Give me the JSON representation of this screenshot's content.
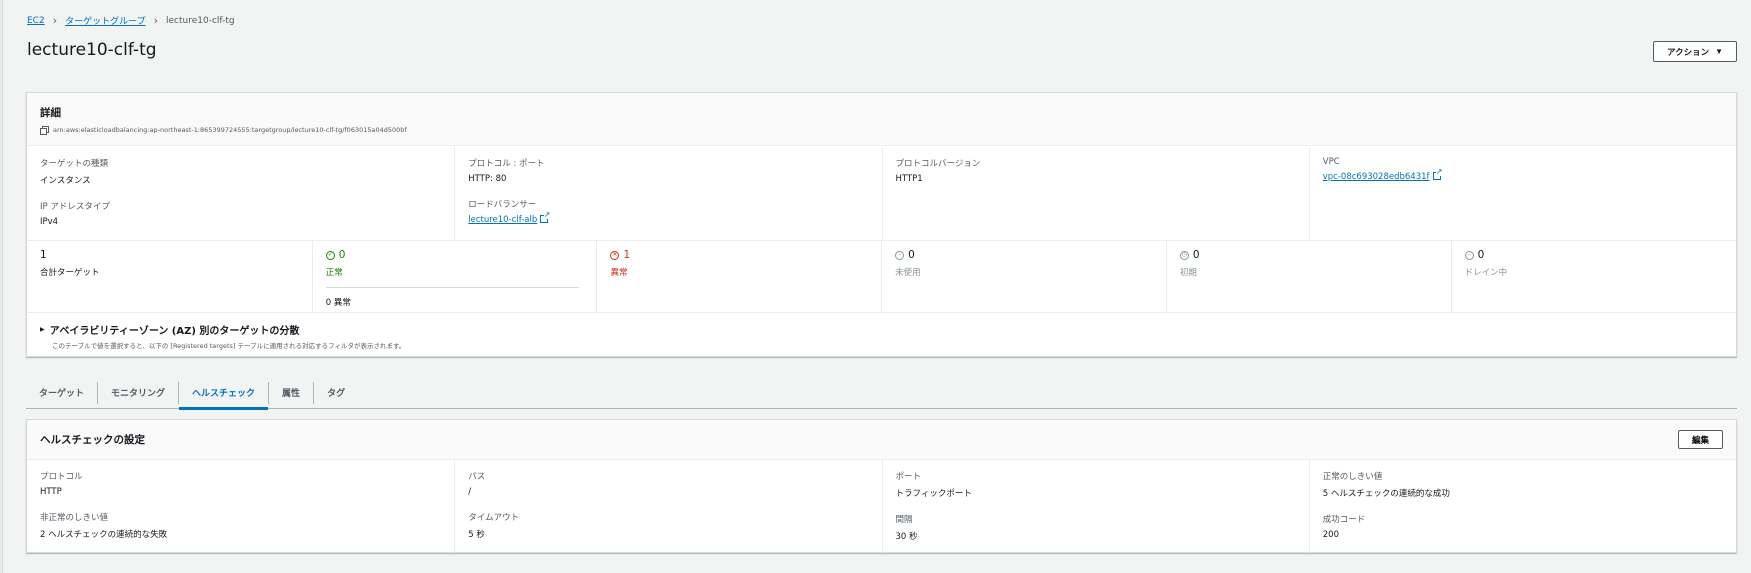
{
  "breadcrumb": {
    "items": [
      "EC2",
      "ターゲットグループ"
    ],
    "current": "lecture10-clf-tg"
  },
  "page": {
    "title": "lecture10-clf-tg",
    "action_label": "アクション"
  },
  "details": {
    "title": "詳細",
    "arn": "arn:aws:elasticloadbalancing:ap-northeast-1:865399724555:targetgroup/lecture10-clf-tg/f063015a04d500bf",
    "target_type_label": "ターゲットの種類",
    "target_type_value": "インスタンス",
    "ip_type_label": "IP アドレスタイプ",
    "ip_type_value": "IPv4",
    "protocol_port_label": "プロトコル : ポート",
    "protocol_port_value": "HTTP: 80",
    "load_balancer_label": "ロードバランサー",
    "load_balancer_value": "lecture10-clf-alb",
    "protocol_version_label": "プロトコルバージョン",
    "protocol_version_value": "HTTP1",
    "vpc_label": "VPC",
    "vpc_value": "vpc-08c693028edb6431f"
  },
  "counts": {
    "total_value": "1",
    "total_label": "合計ターゲット",
    "healthy_value": "0",
    "healthy_label": "正常",
    "healthy_sub": "0 異常",
    "unhealthy_value": "1",
    "unhealthy_label": "異常",
    "unused_value": "0",
    "unused_label": "未使用",
    "initial_value": "0",
    "initial_label": "初期",
    "draining_value": "0",
    "draining_label": "ドレイン中"
  },
  "az": {
    "title": "アベイラビリティーゾーン (AZ) 別のターゲットの分散",
    "desc": "このテーブルで値を選択すると、以下の [Registered targets] テーブルに適用される対応するフィルタが表示されます。"
  },
  "tabs": [
    "ターゲット",
    "モニタリング",
    "ヘルスチェック",
    "属性",
    "タグ"
  ],
  "health_check": {
    "title": "ヘルスチェックの設定",
    "edit_label": "編集",
    "protocol_label": "プロトコル",
    "protocol_value": "HTTP",
    "path_label": "パス",
    "path_value": "/",
    "port_label": "ポート",
    "port_value": "トラフィックポート",
    "healthy_threshold_label": "正常のしきい値",
    "healthy_threshold_value": "5 ヘルスチェックの連続的な成功",
    "unhealthy_threshold_label": "非正常のしきい値",
    "unhealthy_threshold_value": "2 ヘルスチェックの連続的な失敗",
    "timeout_label": "タイムアウト",
    "timeout_value": "5 秒",
    "interval_label": "間隔",
    "interval_value": "30 秒",
    "success_codes_label": "成功コード",
    "success_codes_value": "200"
  },
  "colors": {
    "link": "#0073bb",
    "healthy": "#1d8102",
    "unhealthy": "#d13212",
    "neutral": "#879596"
  },
  "icons": [
    "chevron-right-icon",
    "caret-down-icon",
    "copy-icon",
    "external-link-icon",
    "check-circle-icon",
    "x-circle-icon",
    "dash-circle-icon",
    "clock-circle-icon",
    "triangle-right-icon"
  ]
}
